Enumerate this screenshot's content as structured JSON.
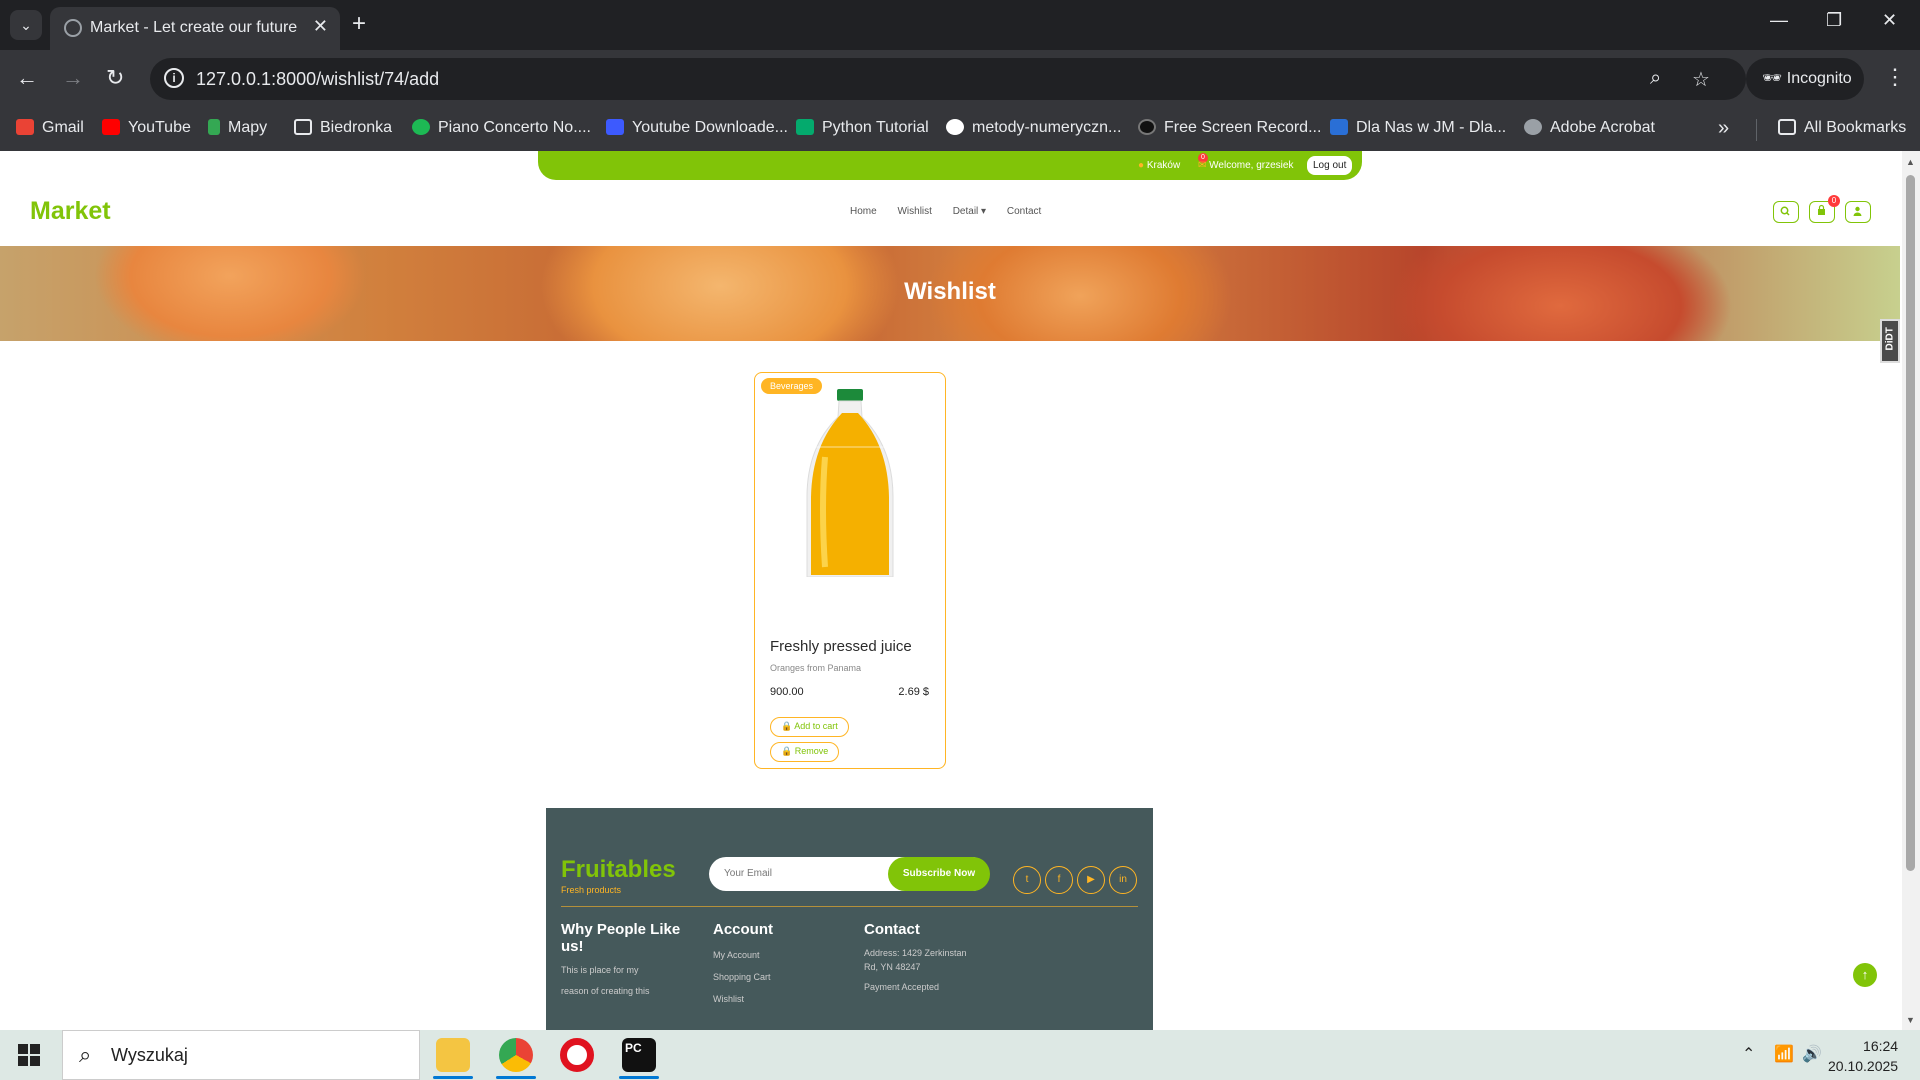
{
  "browser": {
    "tab_title": "Market - Let create our future",
    "url": "127.0.0.1:8000/wishlist/74/add",
    "incognito_label": "Incognito",
    "bookmarks": [
      {
        "label": "Gmail",
        "icon": "gmail-icon",
        "color": "#ea4335"
      },
      {
        "label": "YouTube",
        "icon": "youtube-icon",
        "color": "#ff0000"
      },
      {
        "label": "Mapy",
        "icon": "maps-icon",
        "color": "#34a853"
      },
      {
        "label": "Biedronka",
        "icon": "folder-icon",
        "color": ""
      },
      {
        "label": "Piano Concerto No....",
        "icon": "spotify-icon",
        "color": "#1db954"
      },
      {
        "label": "Youtube Downloade...",
        "icon": "download-icon",
        "color": "#3d5afe"
      },
      {
        "label": "Python Tutorial",
        "icon": "w3schools-icon",
        "color": "#04aa6d"
      },
      {
        "label": "metody-numeryczn...",
        "icon": "github-icon",
        "color": "#ffffff"
      },
      {
        "label": "Free Screen Record...",
        "icon": "recorder-icon",
        "color": "#222222"
      },
      {
        "label": "Dla Nas w JM - Dla...",
        "icon": "dlanas-icon",
        "color": "#2a6fd6"
      },
      {
        "label": "Adobe Acrobat",
        "icon": "globe-icon",
        "color": "#9aa0a6"
      }
    ],
    "all_bookmarks_label": "All Bookmarks"
  },
  "site": {
    "topbar": {
      "location": "Kraków",
      "welcome": "Welcome, grzesiek",
      "mail_count": "0",
      "logout_label": "Log out"
    },
    "brand": "Market",
    "nav": [
      {
        "label": "Home"
      },
      {
        "label": "Wishlist"
      },
      {
        "label": "Detail ▾"
      },
      {
        "label": "Contact"
      }
    ],
    "cart_count": "0",
    "hero_title": "Wishlist",
    "side_tab_label": "DiDT"
  },
  "product": {
    "category": "Beverages",
    "name": "Freshly pressed juice",
    "description": "Oranges from Panama",
    "quantity": "900.00",
    "price": "2.69 $",
    "add_to_cart_label": "Add to cart",
    "remove_label": "Remove"
  },
  "footer": {
    "brand": "Fruitables",
    "tagline": "Fresh products",
    "email_placeholder": "Your Email",
    "subscribe_label": "Subscribe Now",
    "social_icons": [
      "twitter-icon",
      "facebook-icon",
      "youtube-icon",
      "linkedin-icon"
    ],
    "col1": {
      "heading": "Why People Like us!",
      "text": [
        "This is place for my",
        "reason of creating this"
      ]
    },
    "col2": {
      "heading": "Account",
      "links": [
        "My Account",
        "Shopping Cart",
        "Wishlist"
      ]
    },
    "col3": {
      "heading": "Contact",
      "lines": [
        "Address: 1429 Zerkinstan",
        "Rd, YN 48247",
        "Payment Accepted"
      ]
    }
  },
  "taskbar": {
    "search_placeholder": "Wyszukaj",
    "time": "16:24",
    "date": "20.10.2025"
  },
  "colors": {
    "accent": "#81c408",
    "secondary": "#ffb524",
    "footer_bg": "#45595b"
  }
}
